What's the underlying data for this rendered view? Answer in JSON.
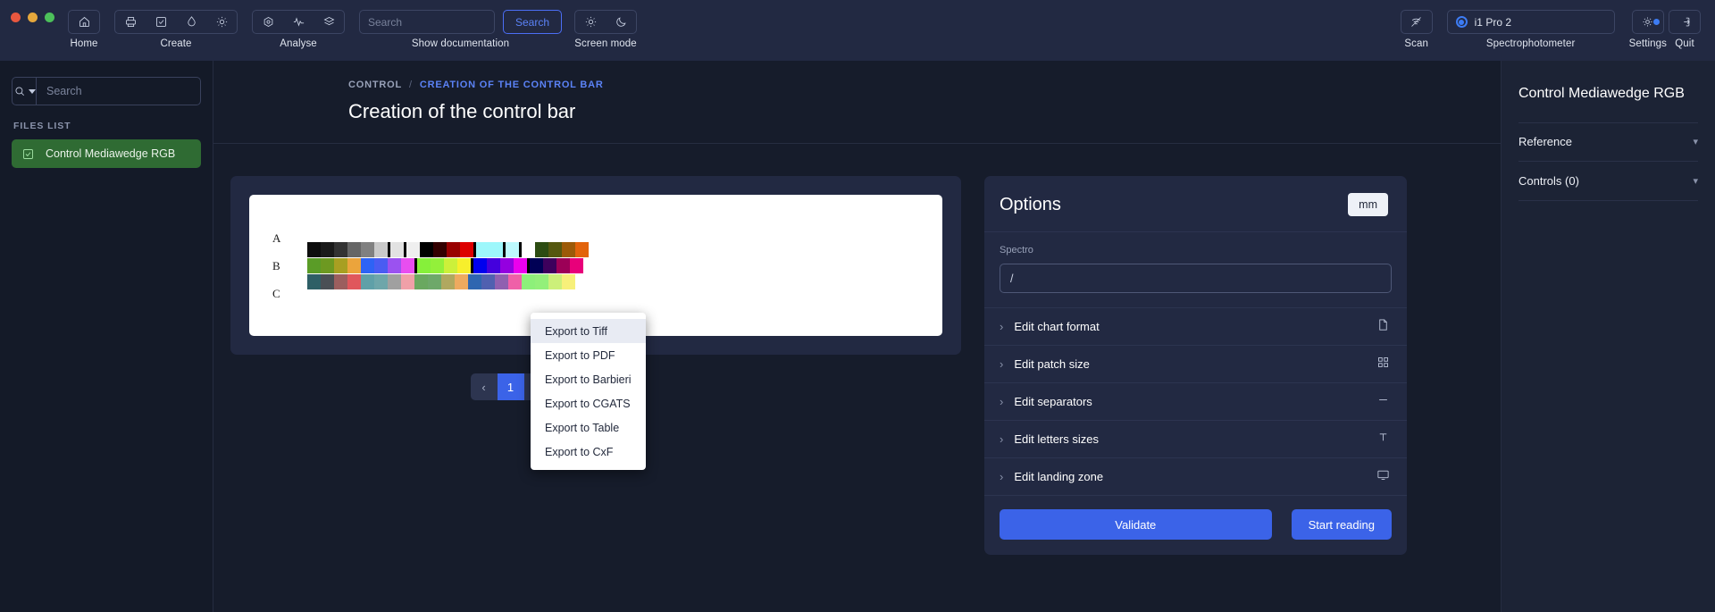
{
  "toolbar": {
    "groups": [
      {
        "label": "Home",
        "icons": [
          "home-icon"
        ]
      },
      {
        "label": "Create",
        "icons": [
          "printer-icon",
          "checklist-icon",
          "droplet-icon",
          "sun-icon"
        ]
      },
      {
        "label": "Analyse",
        "icons": [
          "target-icon",
          "pulse-icon",
          "layers-icon"
        ]
      }
    ],
    "documentation": {
      "label": "Show documentation",
      "placeholder": "Search",
      "value": "",
      "button": "Search"
    },
    "screen_mode": {
      "label": "Screen mode",
      "icons": [
        "sun-icon",
        "moon-icon"
      ]
    },
    "scan": {
      "label": "Scan",
      "icon": "scan-off-icon"
    },
    "spectrophotometer": {
      "label": "Spectrophotometer",
      "value": "i1 Pro 2",
      "icon": "radio-selected-icon"
    },
    "settings": {
      "label": "Settings",
      "icon": "gear-icon",
      "has_badge": true
    },
    "quit": {
      "label": "Quit",
      "icon": "exit-icon"
    }
  },
  "sidebar": {
    "search": {
      "placeholder": "Search",
      "value": ""
    },
    "files_list_label": "FILES LIST",
    "files": [
      {
        "name": "Control Mediawedge RGB",
        "selected": true
      }
    ]
  },
  "breadcrumb": {
    "parent": "CONTROL",
    "separator": "/",
    "current": "CREATION OF THE CONTROL BAR"
  },
  "page": {
    "title": "Creation of the control bar"
  },
  "chart": {
    "row_labels": [
      "A",
      "B",
      "C"
    ],
    "rows": [
      [
        "#0d0d0d",
        "#1a1a1a",
        "#333333",
        "#666666",
        "#808080",
        "#c9c9c9",
        "sep",
        "#e2e2e2",
        "sep",
        "#efefef",
        "#000000",
        "#330000",
        "#990000",
        "#dd0000",
        "sep",
        "#9df7fb",
        "#9df7fb",
        "sep",
        "#bdf9fd",
        "sep",
        "gap",
        "#2d4c12",
        "#55570f",
        "#9c5a08",
        "#e2630b"
      ],
      [
        "#5a9c27",
        "#6d9921",
        "#a89f22",
        "#eba43c",
        "#2e63f5",
        "#4a5cf2",
        "#9b52f0",
        "#e84ef0",
        "sep",
        "#86f03a",
        "#93f03a",
        "#ccf03a",
        "#f7ef2c",
        "sep",
        "#0000ee",
        "#4400dd",
        "#9400e0",
        "#ec00ec",
        "sep",
        "#000055",
        "#3d005c",
        "#9c0057",
        "#e8007a"
      ],
      [
        "#2e5f66",
        "#4a4f55",
        "#9c5e5e",
        "#e0575c",
        "#5fa0a8",
        "#6ea6aa",
        "#a0a0a0",
        "#f0a0a8",
        "#6aa860",
        "#6ea86a",
        "#b0a85f",
        "#eeaa5f",
        "#2f66b0",
        "#5060b0",
        "#9060b0",
        "#ef60a8",
        "#8df07a",
        "#93f07a",
        "#ccf07a",
        "#f7f07a"
      ]
    ],
    "pagination": {
      "prev": "‹",
      "page": "1",
      "next": "›"
    },
    "tools": [
      "crop-icon",
      "download-icon"
    ]
  },
  "export_menu": {
    "items": [
      {
        "label": "Export to Tiff",
        "highlighted": true
      },
      {
        "label": "Export to PDF",
        "highlighted": false
      },
      {
        "label": "Export to Barbieri",
        "highlighted": false
      },
      {
        "label": "Export to CGATS",
        "highlighted": false
      },
      {
        "label": "Export to Table",
        "highlighted": false
      },
      {
        "label": "Export to CxF",
        "highlighted": false
      }
    ]
  },
  "options": {
    "title": "Options",
    "unit": "mm",
    "spectro_label": "Spectro",
    "spectro_value": "/",
    "rows": [
      {
        "label": "Edit chart format",
        "icon": "document-icon"
      },
      {
        "label": "Edit patch size",
        "icon": "grid-icon"
      },
      {
        "label": "Edit separators",
        "icon": "minus-icon"
      },
      {
        "label": "Edit letters sizes",
        "icon": "text-icon"
      },
      {
        "label": "Edit landing zone",
        "icon": "monitor-icon"
      }
    ],
    "validate_label": "Validate",
    "start_reading_label": "Start reading"
  },
  "right_panel": {
    "title": "Control Mediawedge RGB",
    "sections": [
      {
        "label": "Reference"
      },
      {
        "label": "Controls (0)"
      }
    ]
  },
  "colors": {
    "accent": "#3b63e8",
    "link": "#5b82f6",
    "selected_file": "#2f6b33"
  }
}
